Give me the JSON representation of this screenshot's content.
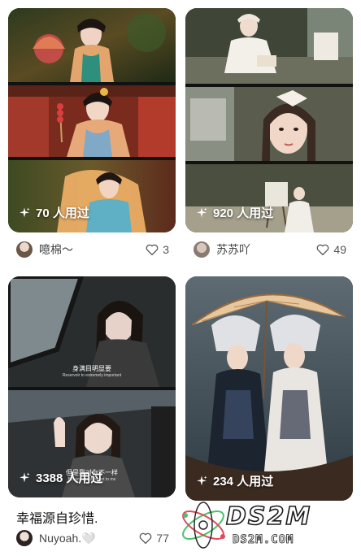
{
  "feed": {
    "cards": [
      {
        "uses": "70 人用过",
        "author": "噫棉～",
        "likes": "3"
      },
      {
        "uses": "920 人用过",
        "author": "苏苏吖",
        "likes": "49"
      },
      {
        "uses": "3388 人用过",
        "title": "幸福源自珍惜.",
        "author": "Nuyoah.🤍",
        "likes": "77",
        "caption1": "身满目明显要",
        "caption1_sub": "Reservoir to extremely important",
        "caption2": "但是我对你不一样",
        "caption2_sub": "But you are different to me"
      },
      {
        "uses": "234 人用过"
      }
    ]
  },
  "watermark": {
    "logo_text": "DS2M",
    "domain": "DS2M.COM"
  },
  "colors": {
    "accent_green": "#46c46a",
    "accent_red": "#e04a5a"
  }
}
